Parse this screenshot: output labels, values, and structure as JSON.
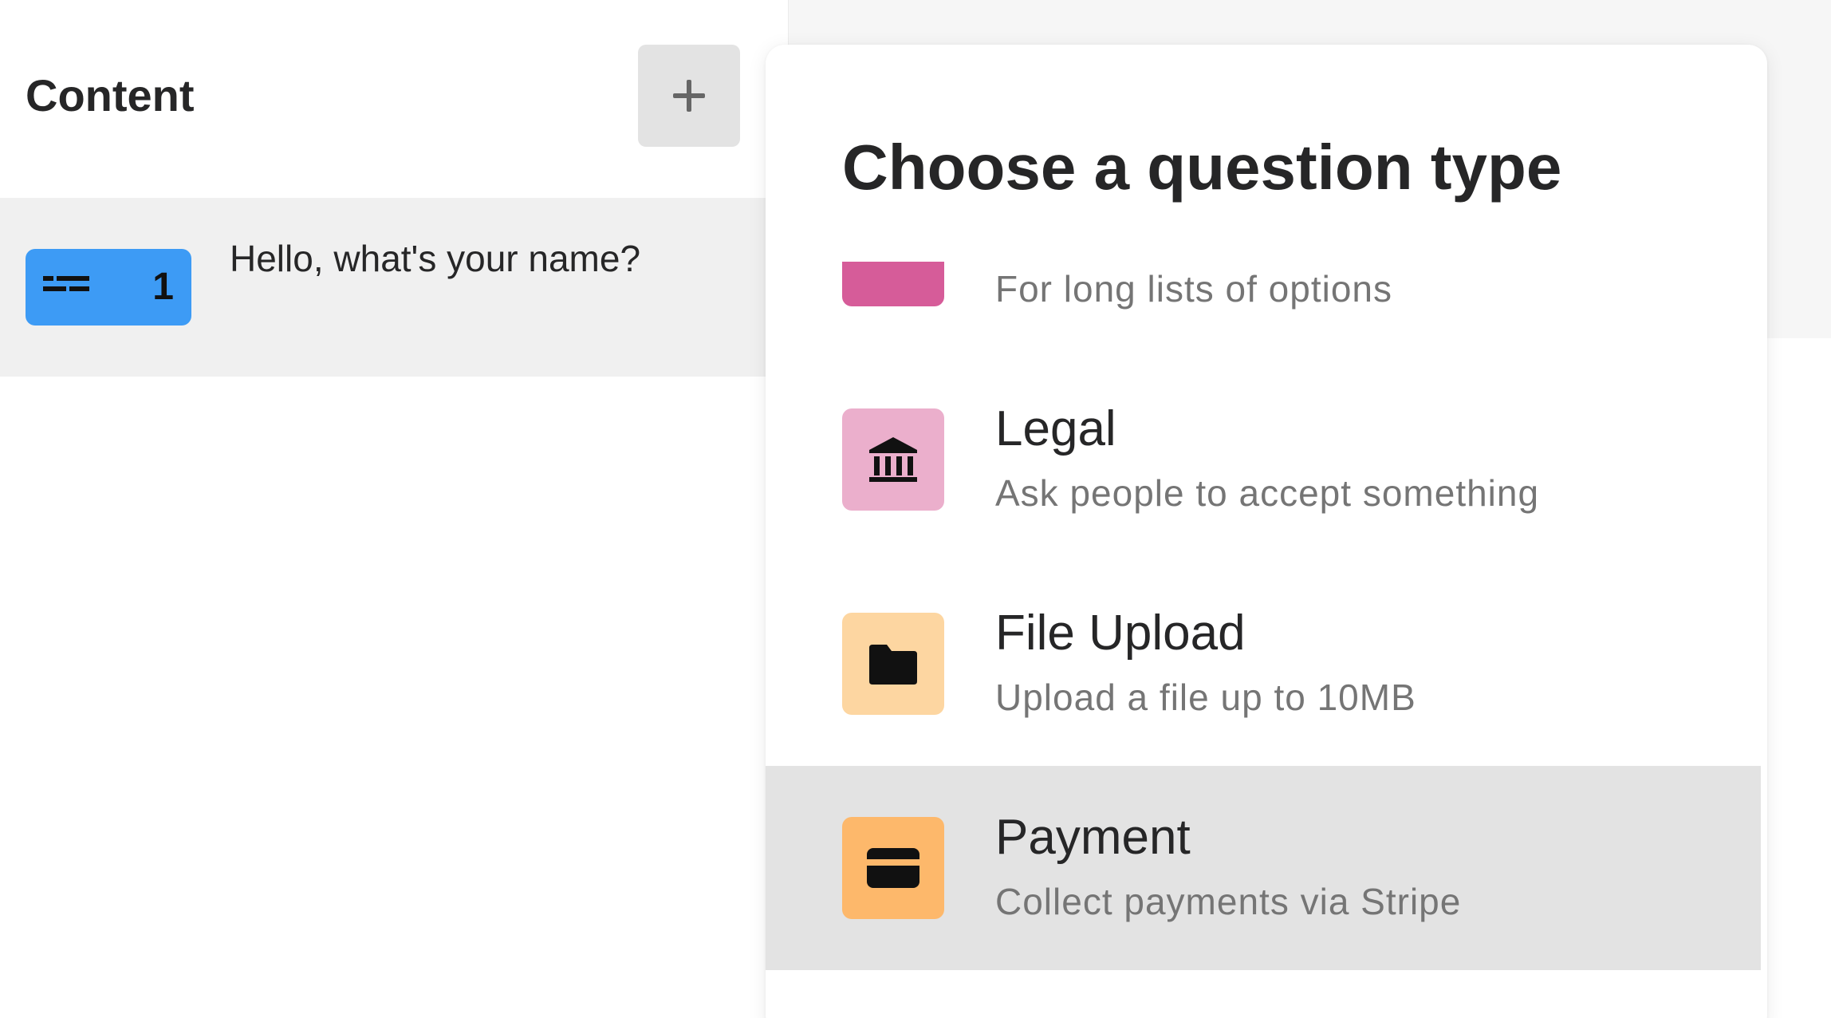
{
  "sidebar": {
    "title": "Content",
    "questions": [
      {
        "number": "1",
        "text": "Hello, what's your name?",
        "icon": "short-text-icon",
        "badge_color": "#3d9bf5"
      }
    ]
  },
  "panel": {
    "title": "Choose a question type",
    "options": [
      {
        "label": "",
        "description": "For long lists of options",
        "icon": "dropdown-icon",
        "color": "#d65c99"
      },
      {
        "label": "Legal",
        "description": "Ask people to accept something",
        "icon": "bank-icon",
        "color": "#ebafcc"
      },
      {
        "label": "File Upload",
        "description": "Upload a file up to 10MB",
        "icon": "folder-icon",
        "color": "#fdd6a1"
      },
      {
        "label": "Payment",
        "description": "Collect payments via Stripe",
        "icon": "credit-card-icon",
        "color": "#fdb86b",
        "highlighted": true
      }
    ]
  }
}
